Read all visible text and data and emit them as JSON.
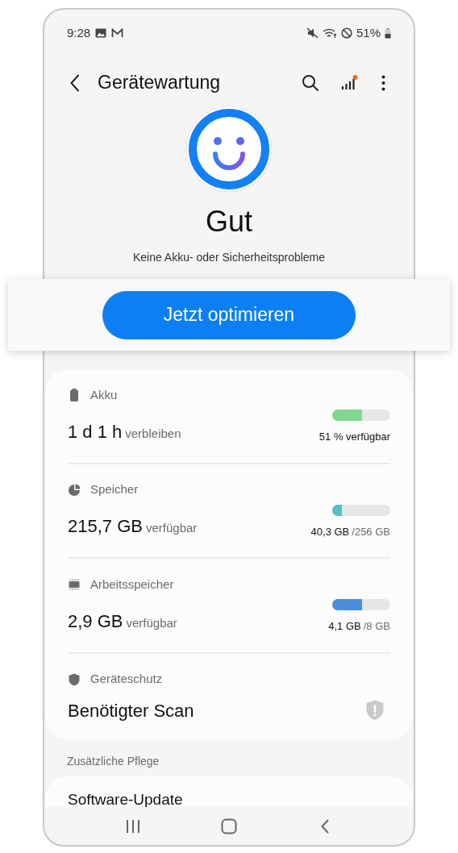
{
  "status_bar": {
    "time": "9:28",
    "battery": "51%"
  },
  "header": {
    "title": "Gerätewartung",
    "notification_dot": true
  },
  "status": {
    "title": "Gut",
    "subtitle": "Keine Akku- oder Sicherheitsprobleme"
  },
  "optimize_button": "Jetzt optimieren",
  "items": [
    {
      "kind": "battery",
      "label": "Akku",
      "value": "1 d 1 h",
      "unit": "verbleiben",
      "level": 0.51,
      "color": "#7ed98f",
      "detail": "51 % verfügbar"
    },
    {
      "kind": "storage",
      "label": "Speicher",
      "value": "215,7 GB",
      "unit": "verfügbar",
      "level": 0.16,
      "color": "#4fc1c3",
      "detail": "40,3 GB",
      "detail_total": "/256 GB"
    },
    {
      "kind": "memory",
      "label": "Arbeitsspeicher",
      "value": "2,9 GB",
      "unit": "verfügbar",
      "level": 0.51,
      "color": "#4a8fdb",
      "detail": "4,1 GB",
      "detail_total": "/8 GB"
    },
    {
      "kind": "protection",
      "label": "Geräteschutz",
      "value": "Benötigter Scan"
    }
  ],
  "section": {
    "title": "Zusätzliche Pflege",
    "items": [
      "Software-Update"
    ]
  }
}
